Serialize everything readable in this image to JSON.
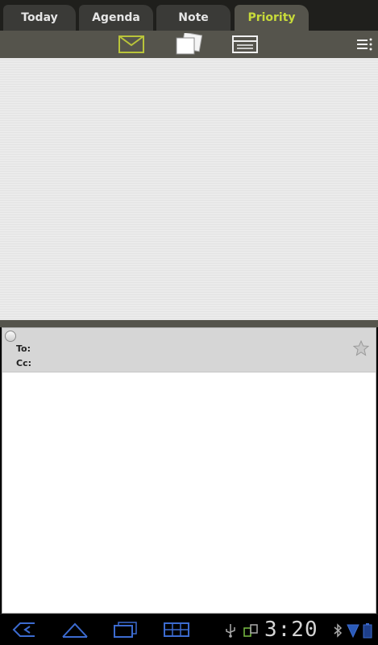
{
  "tabs": [
    {
      "label": "Today",
      "active": false
    },
    {
      "label": "Agenda",
      "active": false
    },
    {
      "label": "Note",
      "active": false
    },
    {
      "label": "Priority",
      "active": true
    }
  ],
  "toolbar": {
    "icons": [
      "mail-icon",
      "document-icon",
      "list-icon",
      "overflow-menu-icon"
    ]
  },
  "message": {
    "to_label": "To:",
    "cc_label": "Cc:",
    "to_value": "",
    "cc_value": "",
    "starred": false
  },
  "system_bar": {
    "time": "3:20",
    "nav_icons": [
      "back-icon",
      "home-icon",
      "recent-apps-icon",
      "app-grid-icon"
    ],
    "status_icons": [
      "usb-icon",
      "debug-icon",
      "bluetooth-icon",
      "wifi-icon",
      "battery-icon"
    ]
  },
  "colors": {
    "active_tab_text": "#c8db3a",
    "toolbar_bg": "#55544c",
    "tab_bg": "#3a3a37",
    "header_bg": "#d6d6d6"
  }
}
